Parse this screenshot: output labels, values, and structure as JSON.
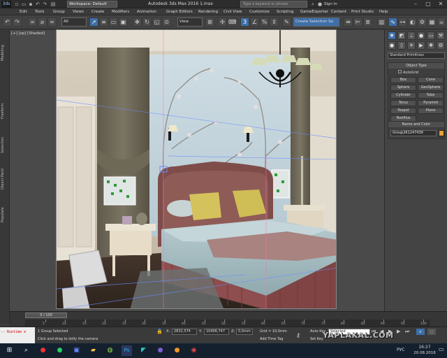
{
  "title": {
    "workspace_label": "Workspace: Default",
    "app_title": "Autodesk 3ds Max 2016    1.max",
    "help_search_placeholder": "Type a keyword or phrase",
    "sign_in": "Sign In"
  },
  "menu": [
    "Edit",
    "Tools",
    "Group",
    "Views",
    "Create",
    "Modifiers",
    "Animation",
    "Graph Editors",
    "Rendering",
    "Civil View",
    "Customize",
    "Scripting",
    "GameExporter",
    "Content",
    "Print Studio",
    "Help"
  ],
  "toolbar": {
    "selection_filter": "All",
    "ref_coord": "View",
    "named_selection": "Create Selection Se"
  },
  "viewport": {
    "label": "[+] [Camera001] [Shaded]",
    "label_short": "[+] [sp] [Shaded]"
  },
  "left_tabs": [
    "Modeling",
    "Freeform",
    "Selection",
    "Object Paint",
    "Populate"
  ],
  "command_panel": {
    "primitives_dropdown": "Standard Primitives",
    "object_type_title": "Object Type",
    "autogrid": "AutoGrid",
    "buttons": [
      "Box",
      "Cone",
      "Sphere",
      "GeoSphere",
      "Cylinder",
      "Tube",
      "Torus",
      "Pyramid",
      "Teapot",
      "Plane",
      "TextPlus"
    ],
    "name_color_title": "Name and Color",
    "object_name": "Group261247439",
    "object_color": "#e8a23c"
  },
  "timeline": {
    "slider": "0 / 100",
    "ticks": [
      "5",
      "10",
      "15",
      "20",
      "25",
      "30",
      "35",
      "40",
      "45",
      "50",
      "55",
      "60",
      "65",
      "70",
      "75",
      "80",
      "85",
      "90",
      "95",
      "100"
    ]
  },
  "status": {
    "maxscript": "-- Runtime e",
    "selection": "1 Group Selected",
    "prompt": "Click and drag to dolly the camera",
    "x_value": "2832,574",
    "y_value": "10406,747",
    "z_value": "0,0mm",
    "grid": "Grid = 10,0mm",
    "add_time_tag": "Add Time Tag",
    "auto_key": "Auto Key",
    "set_key": "Set Key",
    "key_mode": "Selected"
  },
  "taskbar": {
    "lang": "РУС",
    "time": "16:27",
    "date": "20.08.2018"
  },
  "watermark": "YAPLAKAL.COM"
}
